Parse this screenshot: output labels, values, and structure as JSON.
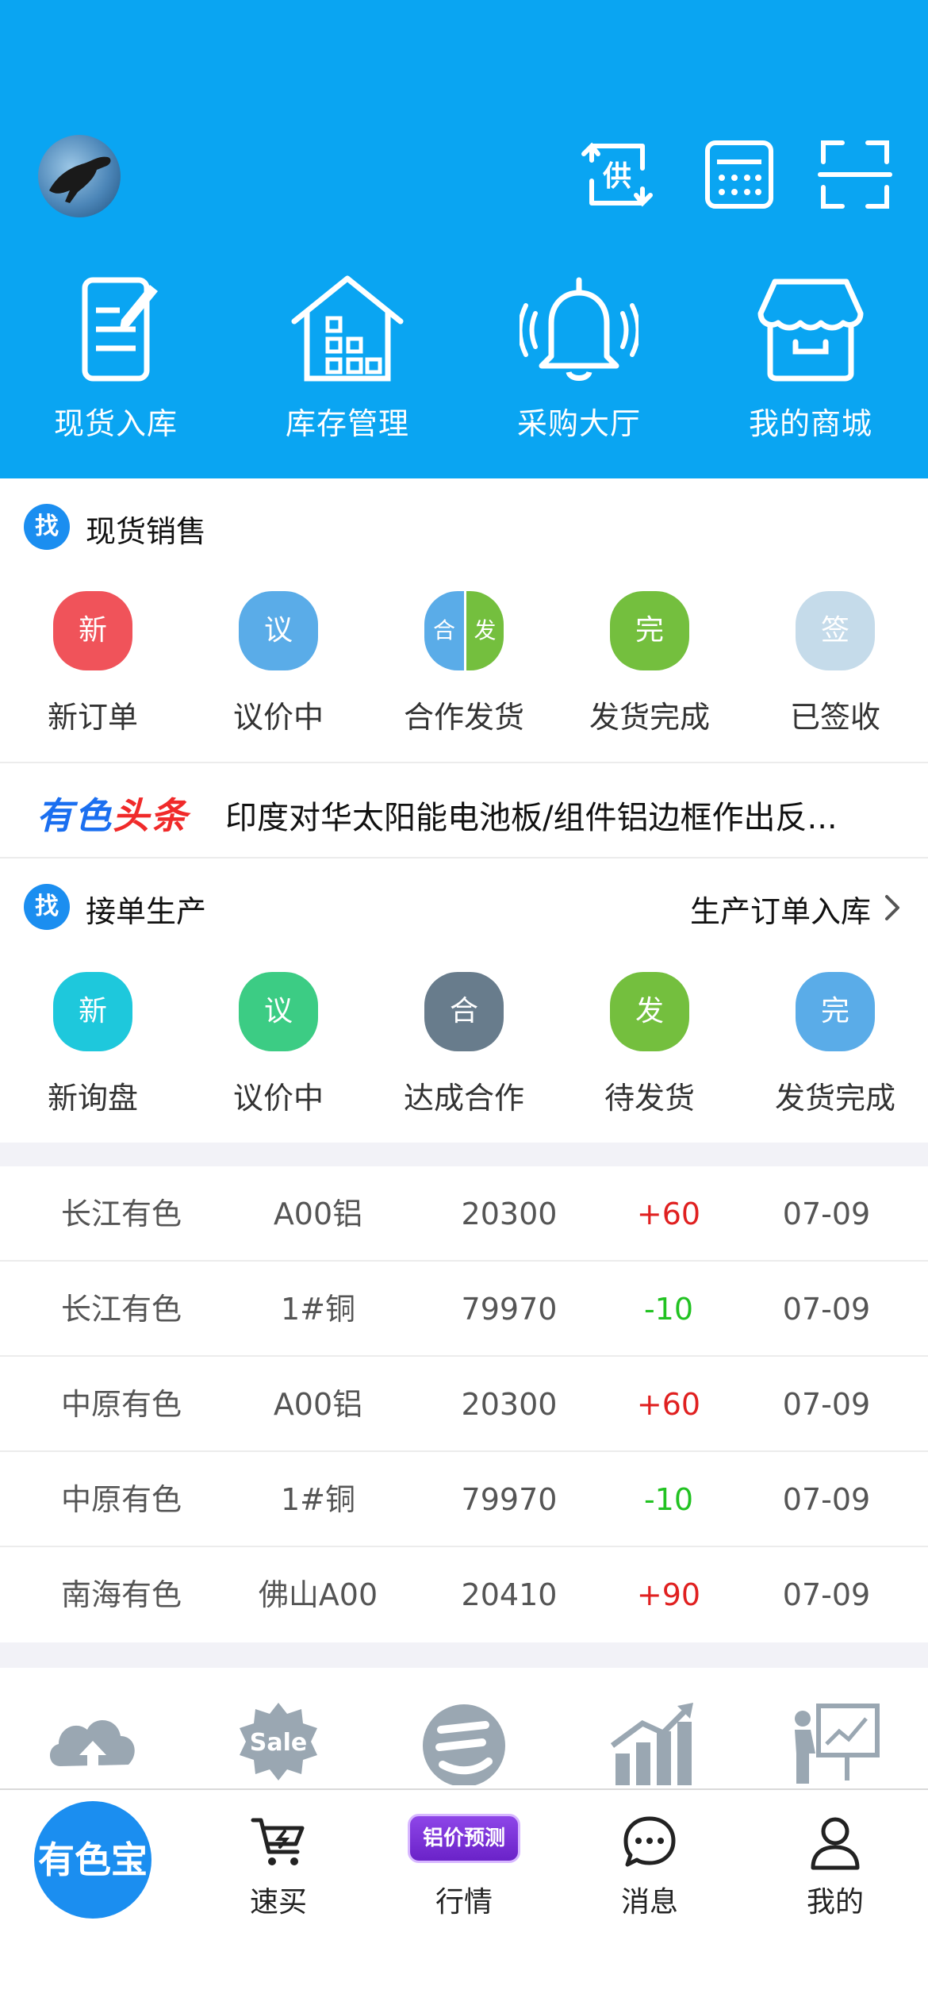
{
  "colors": {
    "primary": "#0aa5f2",
    "accent": "#1b8ef0",
    "up": "#e02020",
    "down": "#22c222"
  },
  "header": {
    "avatar": "avatar",
    "top_icons": [
      "supply-swap-icon",
      "calculator-icon",
      "scan-icon"
    ],
    "supply_icon_char": "供",
    "tiles": [
      {
        "label": "现货入库",
        "icon": "edit-document-icon"
      },
      {
        "label": "库存管理",
        "icon": "warehouse-icon"
      },
      {
        "label": "采购大厅",
        "icon": "bell-icon"
      },
      {
        "label": "我的商城",
        "icon": "store-icon"
      }
    ]
  },
  "spot_sales": {
    "badge": "找",
    "title": "现货销售",
    "items": [
      {
        "char": "新",
        "label": "新订单",
        "color": "#f0535a"
      },
      {
        "char": "议",
        "label": "议价中",
        "color": "#5aace8"
      },
      {
        "char_left": "合",
        "char_right": "发",
        "label": "合作发货",
        "color_left": "#5aace8",
        "color_right": "#74bf3e"
      },
      {
        "char": "完",
        "label": "发货完成",
        "color": "#74bf3e"
      },
      {
        "char": "签",
        "label": "已签收",
        "color": "#c5dbea"
      }
    ]
  },
  "headline": {
    "logo_part1": "有色",
    "logo_part2": "头条",
    "text": "印度对华太阳能电池板/组件铝边框作出反..."
  },
  "production": {
    "badge": "找",
    "title": "接单生产",
    "link": "生产订单入库",
    "items": [
      {
        "char": "新",
        "label": "新询盘",
        "color": "#1ec8dc"
      },
      {
        "char": "议",
        "label": "议价中",
        "color": "#3ccc84"
      },
      {
        "char": "合",
        "label": "达成合作",
        "color": "#687c8c"
      },
      {
        "char": "发",
        "label": "待发货",
        "color": "#74bf3e"
      },
      {
        "char": "完",
        "label": "发货完成",
        "color": "#5aace8"
      }
    ]
  },
  "prices": [
    {
      "market": "长江有色",
      "product": "A00铝",
      "price": "20300",
      "change": "+60",
      "date": "07-09",
      "dir": "up"
    },
    {
      "market": "长江有色",
      "product": "1#铜",
      "price": "79970",
      "change": "-10",
      "date": "07-09",
      "dir": "down"
    },
    {
      "market": "中原有色",
      "product": "A00铝",
      "price": "20300",
      "change": "+60",
      "date": "07-09",
      "dir": "up"
    },
    {
      "market": "中原有色",
      "product": "1#铜",
      "price": "79970",
      "change": "-10",
      "date": "07-09",
      "dir": "down"
    },
    {
      "market": "南海有色",
      "product": "佛山A00",
      "price": "20410",
      "change": "+90",
      "date": "07-09",
      "dir": "up"
    }
  ],
  "features": [
    {
      "icon": "cloud-upload-icon"
    },
    {
      "icon": "sale-badge-icon",
      "text": "Sale"
    },
    {
      "icon": "logo-e-icon"
    },
    {
      "icon": "bar-chart-icon"
    },
    {
      "icon": "presentation-icon"
    }
  ],
  "tabbar": {
    "home": "有色宝",
    "tabs": [
      {
        "label": "速买",
        "icon": "cart-icon"
      },
      {
        "label": "行情",
        "icon": "price-forecast-badge",
        "badge": "铝价预测"
      },
      {
        "label": "消息",
        "icon": "message-icon"
      },
      {
        "label": "我的",
        "icon": "user-icon"
      }
    ]
  }
}
